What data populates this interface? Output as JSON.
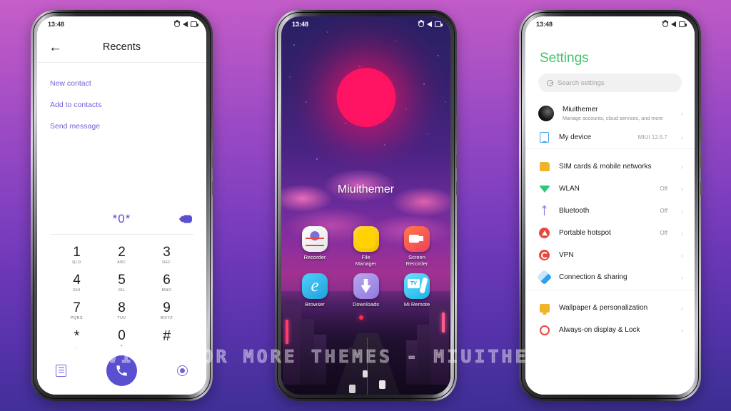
{
  "watermark": "VISIT FOR MORE THEMES - MIUITHEMER.COM",
  "colors": {
    "bg_top": "#c65ec9",
    "bg_bottom": "#3b2e90",
    "dialer_accent": "#5b4fd1",
    "settings_title": "#3ec46a",
    "sun": "#ff1464"
  },
  "phone1": {
    "status": {
      "time": "13:48",
      "icons": [
        "alarm-icon",
        "signal-icon",
        "battery-icon"
      ]
    },
    "appbar": {
      "back": "←",
      "title": "Recents"
    },
    "actions": [
      "New contact",
      "Add to contacts",
      "Send message"
    ],
    "dialed_number": "*0*",
    "keys": [
      {
        "num": "1",
        "sub": "QLD"
      },
      {
        "num": "2",
        "sub": "ABC"
      },
      {
        "num": "3",
        "sub": "DEF"
      },
      {
        "num": "4",
        "sub": "GHI"
      },
      {
        "num": "5",
        "sub": "JKL"
      },
      {
        "num": "6",
        "sub": "MNO"
      },
      {
        "num": "7",
        "sub": "PQRS"
      },
      {
        "num": "8",
        "sub": "TUV"
      },
      {
        "num": "9",
        "sub": "WXYZ"
      },
      {
        "num": "*",
        "sub": ","
      },
      {
        "num": "0",
        "sub": "+"
      },
      {
        "num": "#",
        "sub": ""
      }
    ],
    "bottom": {
      "keypad_icon": "keypad-list-icon",
      "call_icon": "call-icon",
      "more_icon": "contacts-dot-icon"
    }
  },
  "phone2": {
    "status": {
      "time": "13:48",
      "icons": [
        "alarm-icon",
        "signal-icon",
        "battery-icon"
      ]
    },
    "wallpaper_label": "Miuithemer",
    "apps_row1": [
      {
        "name": "Recorder",
        "icon": "recorder-icon"
      },
      {
        "name": "File\nManager",
        "line1": "File",
        "line2": "Manager",
        "icon": "file-manager-icon"
      },
      {
        "name": "Screen\nRecorder",
        "line1": "Screen",
        "line2": "Recorder",
        "icon": "screen-recorder-icon"
      }
    ],
    "apps_row2": [
      {
        "name": "Browser",
        "line1": "Browser",
        "line2": "",
        "icon": "browser-icon"
      },
      {
        "name": "Downloads",
        "line1": "Downloads",
        "line2": "",
        "icon": "downloads-icon"
      },
      {
        "name": "Mi Remote",
        "line1": "Mi Remote",
        "line2": "",
        "icon": "mi-remote-icon"
      }
    ]
  },
  "phone3": {
    "status": {
      "time": "13:48",
      "icons": [
        "alarm-icon",
        "signal-icon",
        "battery-icon"
      ]
    },
    "title": "Settings",
    "search": {
      "placeholder": "Search settings",
      "icon": "search-icon"
    },
    "account": {
      "name": "Miuithemer",
      "subtitle": "Manage accounts, cloud services, and more",
      "avatar": "user-avatar"
    },
    "device": {
      "label": "My device",
      "value": "MIUI 12.5.7",
      "icon": "device-icon"
    },
    "items": [
      {
        "label": "SIM cards & mobile networks",
        "value": "",
        "icon": "sim-card-icon"
      },
      {
        "label": "WLAN",
        "value": "Off",
        "icon": "wifi-icon"
      },
      {
        "label": "Bluetooth",
        "value": "Off",
        "icon": "bluetooth-icon"
      },
      {
        "label": "Portable hotspot",
        "value": "Off",
        "icon": "hotspot-icon"
      },
      {
        "label": "VPN",
        "value": "",
        "icon": "vpn-icon"
      },
      {
        "label": "Connection & sharing",
        "value": "",
        "icon": "connection-sharing-icon"
      }
    ],
    "items2": [
      {
        "label": "Wallpaper & personalization",
        "value": "",
        "icon": "wallpaper-icon"
      },
      {
        "label": "Always-on display & Lock",
        "value": "",
        "icon": "always-on-display-icon"
      }
    ],
    "chevron": "›"
  }
}
